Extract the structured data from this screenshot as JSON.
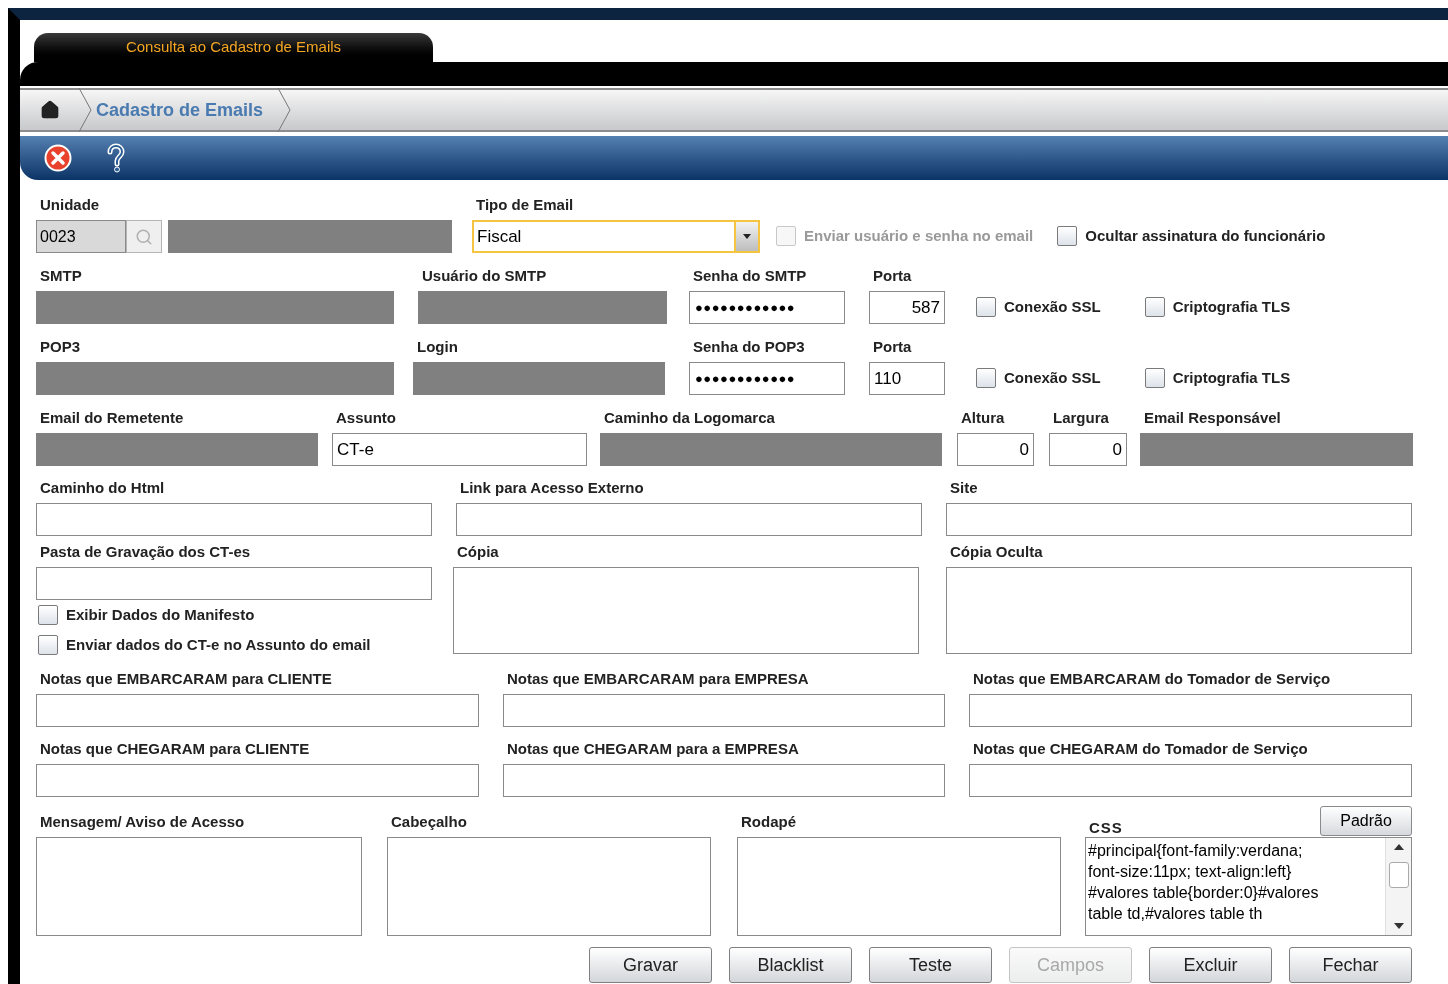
{
  "tab": {
    "label": "Consulta ao Cadastro de Emails",
    "selected": true
  },
  "breadcrumb": {
    "label": "Cadastro de Emails"
  },
  "rows": [
    {
      "items": [
        {
          "kind": "lookup",
          "label": "Unidade",
          "value": "0023"
        },
        {
          "kind": "select",
          "label": "Tipo de Email",
          "value": "Fiscal"
        },
        {
          "kind": "checkbox",
          "label": "Enviar usuário e senha no email",
          "checked": false,
          "disabled": true
        },
        {
          "kind": "checkbox",
          "label": "Ocultar assinatura do funcionário",
          "checked": false,
          "disabled": false
        }
      ]
    },
    {
      "items": [
        {
          "kind": "masked",
          "label": "SMTP"
        },
        {
          "kind": "masked",
          "label": "Usuário do SMTP"
        },
        {
          "kind": "password",
          "label": "Senha do SMTP",
          "value": "●●●●●●●●●●●●"
        },
        {
          "kind": "text",
          "label": "Porta",
          "value": "587",
          "right_aligned": true
        },
        {
          "kind": "checkbox",
          "label": "Conexão SSL",
          "checked": false,
          "disabled": false
        },
        {
          "kind": "checkbox",
          "label": "Criptografia TLS",
          "checked": false,
          "disabled": false
        }
      ]
    },
    {
      "items": [
        {
          "kind": "masked",
          "label": "POP3"
        },
        {
          "kind": "masked",
          "label": "Login"
        },
        {
          "kind": "password",
          "label": "Senha do POP3",
          "value": "●●●●●●●●●●●●"
        },
        {
          "kind": "text",
          "label": "Porta",
          "value": "110",
          "right_aligned": false
        },
        {
          "kind": "checkbox",
          "label": "Conexão SSL",
          "checked": false,
          "disabled": false
        },
        {
          "kind": "checkbox",
          "label": "Criptografia TLS",
          "checked": false,
          "disabled": false
        }
      ]
    },
    {
      "items": [
        {
          "kind": "masked",
          "label": "Email do Remetente"
        },
        {
          "kind": "text",
          "label": "Assunto",
          "value": "CT-e",
          "right_aligned": false
        },
        {
          "kind": "masked",
          "label": "Caminho da Logomarca"
        },
        {
          "kind": "text",
          "label": "Altura",
          "value": "0",
          "right_aligned": true
        },
        {
          "kind": "text",
          "label": "Largura",
          "value": "0",
          "right_aligned": true
        },
        {
          "kind": "masked",
          "label": "Email Responsável"
        }
      ]
    },
    {
      "items": [
        {
          "kind": "text",
          "label": "Caminho do Html"
        },
        {
          "kind": "text",
          "label": "Link para Acesso Externo"
        },
        {
          "kind": "text",
          "label": "Site"
        }
      ]
    },
    {
      "items": [
        {
          "kind": "group",
          "items": [
            {
              "kind": "text",
              "label": "Pasta de Gravação dos CT-es"
            },
            {
              "kind": "checkbox",
              "label": "Exibir Dados do Manifesto",
              "checked": false,
              "disabled": false
            },
            {
              "kind": "checkbox",
              "label": "Enviar dados do CT-e no Assunto do email",
              "checked": false,
              "disabled": false
            }
          ]
        },
        {
          "kind": "textarea",
          "label": "Cópia"
        },
        {
          "kind": "textarea",
          "label": "Cópia Oculta"
        }
      ]
    },
    {
      "items": [
        {
          "kind": "text",
          "label": "Notas que EMBARCARAM para CLIENTE"
        },
        {
          "kind": "text",
          "label": "Notas que EMBARCARAM para EMPRESA"
        },
        {
          "kind": "text",
          "label": "Notas que EMBARCARAM do Tomador de Serviço"
        }
      ]
    },
    {
      "items": [
        {
          "kind": "text",
          "label": "Notas que CHEGARAM para CLIENTE"
        },
        {
          "kind": "text",
          "label": "Notas que CHEGARAM para a EMPRESA"
        },
        {
          "kind": "text",
          "label": "Notas que CHEGARAM do Tomador de Serviço"
        }
      ]
    },
    {
      "items": [
        {
          "kind": "textarea",
          "label": "Mensagem/ Aviso de Acesso"
        },
        {
          "kind": "textarea",
          "label": "Cabeçalho"
        },
        {
          "kind": "textarea",
          "label": "Rodapé"
        },
        {
          "kind": "code",
          "label": "CSS",
          "button": "Padrão",
          "lines": [
            "#principal{font-family:verdana;",
            "font-size:11px;  text-align:left}",
            "#valores table{border:0}#valores",
            "table td,#valores table th"
          ]
        }
      ]
    }
  ],
  "buttons": [
    {
      "label": "Gravar",
      "disabled": false
    },
    {
      "label": "Blacklist",
      "disabled": false
    },
    {
      "label": "Teste",
      "disabled": false
    },
    {
      "label": "Campos",
      "disabled": true
    },
    {
      "label": "Excluir",
      "disabled": false
    },
    {
      "label": "Fechar",
      "disabled": false
    }
  ]
}
